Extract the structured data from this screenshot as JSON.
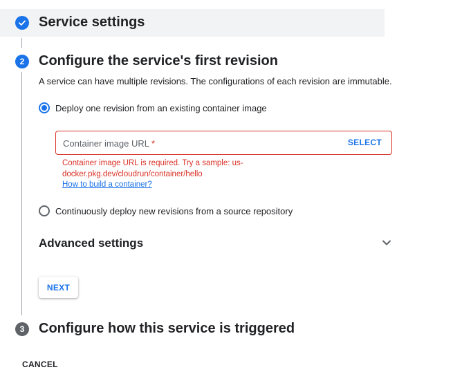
{
  "steps": {
    "step1": {
      "title": "Service settings",
      "status_icon": "check-icon"
    },
    "step2": {
      "number": "2",
      "title": "Configure the service's first revision"
    },
    "step3": {
      "number": "3",
      "title": "Configure how this service is triggered"
    }
  },
  "revision": {
    "description": "A service can have multiple revisions. The configurations of each revision are immutable.",
    "option_existing_image": {
      "label": "Deploy one revision from an existing container image",
      "selected": true
    },
    "option_source_repo": {
      "label": "Continuously deploy new revisions from a source repository",
      "selected": false
    },
    "container_image": {
      "label": "Container image URL",
      "required_marker": "*",
      "value": "",
      "select_label": "SELECT",
      "error": "Container image URL is required. Try a sample: us-docker.pkg.dev/cloudrun/container/hello",
      "help_link": "How to build a container?"
    },
    "advanced_settings": {
      "label": "Advanced settings",
      "icon": "chevron-down-icon",
      "expanded": false
    },
    "next_label": "NEXT"
  },
  "footer": {
    "cancel_label": "CANCEL"
  },
  "colors": {
    "accent": "#1a73e8",
    "error": "#d93025",
    "completed_step_bg": "#f1f3f4",
    "inactive_step": "#5f6368"
  }
}
